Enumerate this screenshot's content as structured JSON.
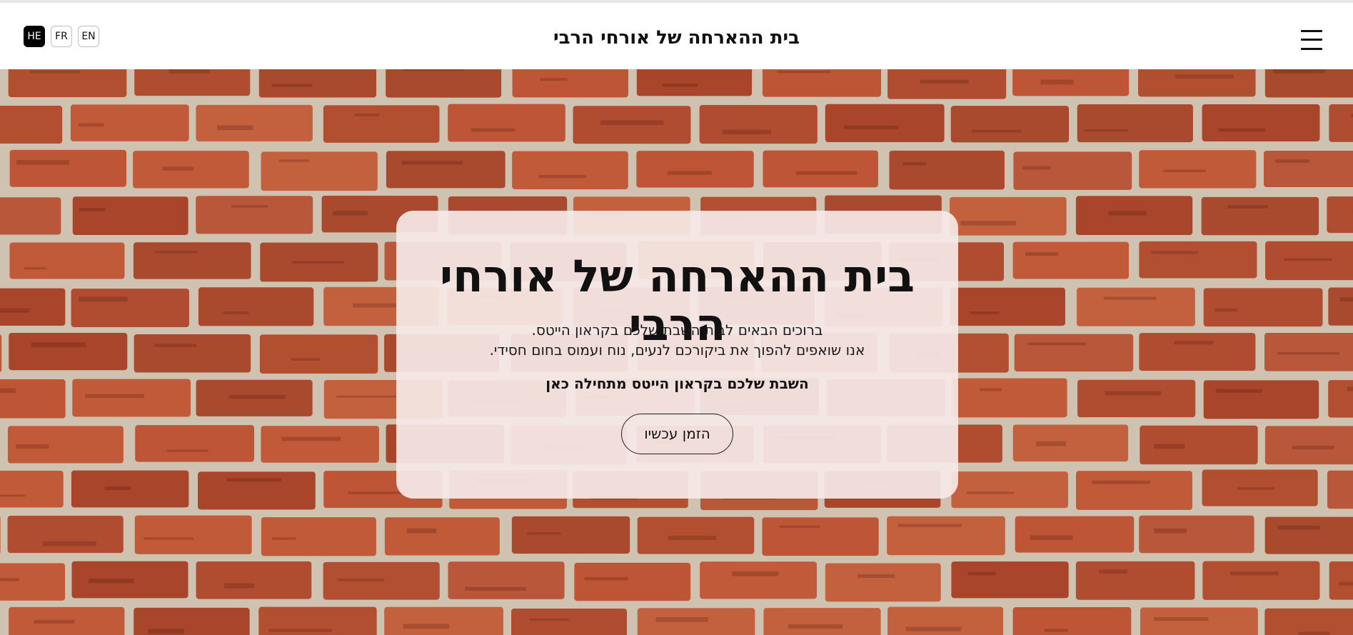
{
  "header": {
    "title": "בית ההארחה של אורחי הרבי",
    "languages": [
      "HE",
      "FR",
      "EN"
    ],
    "active_language": "HE"
  },
  "hero": {
    "heading": "בית ההארחה של אורחי הרבי",
    "intro_line_1": "ברוכים הבאים לבית השבת שלכם בקראון הייטס.",
    "intro_line_2": "אנו שואפים להפוך את ביקורכם לנעים, נוח ועמוס בחום חסידי.",
    "tagline": "השבת שלכם בקראון הייטס מתחילה כאן",
    "cta_label": "הזמן עכשיו"
  },
  "colors": {
    "brick": "#b85233",
    "mortar": "#cfc2b0",
    "card_background": "#f5e8e6",
    "text": "#111111",
    "active_language_bg": "#000000"
  },
  "icons": {
    "menu": "hamburger-menu-icon"
  }
}
